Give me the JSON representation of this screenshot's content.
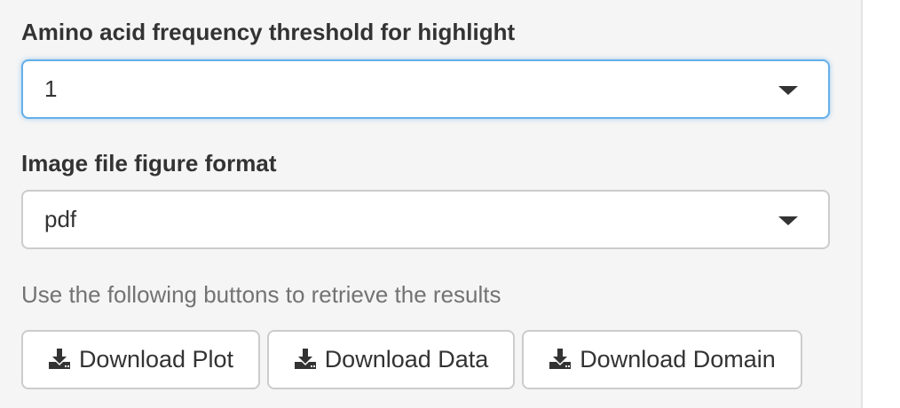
{
  "threshold": {
    "label": "Amino acid frequency threshold for highlight",
    "value": "1"
  },
  "format": {
    "label": "Image file figure format",
    "value": "pdf"
  },
  "help_text": "Use the following buttons to retrieve the results",
  "buttons": [
    {
      "label": "Download Plot",
      "icon": "download-icon"
    },
    {
      "label": "Download Data",
      "icon": "download-icon"
    },
    {
      "label": "Download Domain",
      "icon": "download-icon"
    }
  ],
  "colors": {
    "panel_bg": "#f5f5f5",
    "focus_border": "#66afe9",
    "text": "#333333",
    "help_text": "#737373"
  }
}
